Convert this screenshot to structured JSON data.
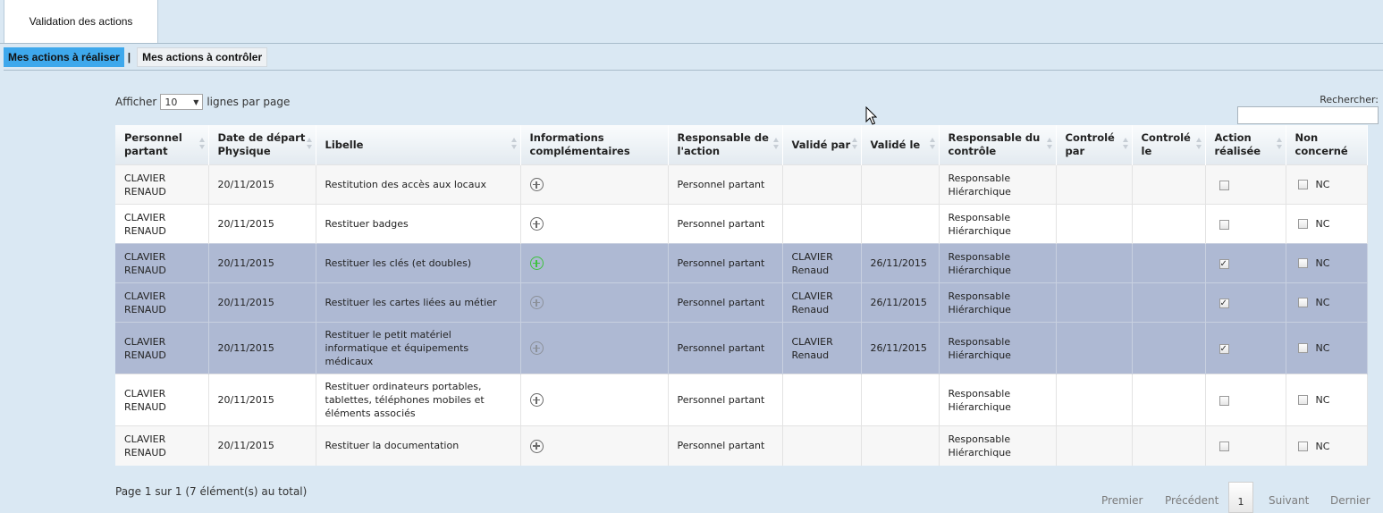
{
  "window": {
    "tab_title": "Validation des actions"
  },
  "subtabs": [
    {
      "label": "Mes actions à réaliser",
      "active": true
    },
    {
      "label": "Mes actions à contrôler",
      "active": false
    }
  ],
  "subtab_separator": "|",
  "length": {
    "prefix": "Afficher",
    "value": "10",
    "suffix": "lignes par page"
  },
  "search": {
    "label": "Rechercher:",
    "value": ""
  },
  "table": {
    "headers": [
      "Personnel partant",
      "Date de départ Physique",
      "Libelle",
      "Informations complémentaires",
      "Responsable de l'action",
      "Validé par",
      "Validé le",
      "Responsable du contrôle",
      "Controlé par",
      "Controlé le",
      "Action réalisée",
      "Non concerné"
    ],
    "rows": [
      {
        "personnel": "CLAVIER RENAUD",
        "date": "20/11/2015",
        "libelle": "Restitution des accès aux locaux",
        "responsable": "Personnel partant",
        "valide_par": "",
        "valide_le": "",
        "resp_controle": "Responsable Hiérarchique",
        "controle_par": "",
        "controle_le": "",
        "realisee": false,
        "nc_label": "NC",
        "nc": false
      },
      {
        "personnel": "CLAVIER RENAUD",
        "date": "20/11/2015",
        "libelle": "Restituer badges",
        "responsable": "Personnel partant",
        "valide_par": "",
        "valide_le": "",
        "resp_controle": "Responsable Hiérarchique",
        "controle_par": "",
        "controle_le": "",
        "realisee": false,
        "nc_label": "NC",
        "nc": false
      },
      {
        "personnel": "CLAVIER RENAUD",
        "date": "20/11/2015",
        "libelle": "Restituer les clés (et doubles)",
        "responsable": "Personnel partant",
        "valide_par": "CLAVIER Renaud",
        "valide_le": "26/11/2015",
        "resp_controle": "Responsable Hiérarchique",
        "controle_par": "",
        "controle_le": "",
        "realisee": true,
        "nc_label": "NC",
        "nc": false
      },
      {
        "personnel": "CLAVIER RENAUD",
        "date": "20/11/2015",
        "libelle": "Restituer les cartes liées au métier",
        "responsable": "Personnel partant",
        "valide_par": "CLAVIER Renaud",
        "valide_le": "26/11/2015",
        "resp_controle": "Responsable Hiérarchique",
        "controle_par": "",
        "controle_le": "",
        "realisee": true,
        "nc_label": "NC",
        "nc": false
      },
      {
        "personnel": "CLAVIER RENAUD",
        "date": "20/11/2015",
        "libelle": "Restituer le petit matériel informatique et équipements médicaux",
        "responsable": "Personnel partant",
        "valide_par": "CLAVIER Renaud",
        "valide_le": "26/11/2015",
        "resp_controle": "Responsable Hiérarchique",
        "controle_par": "",
        "controle_le": "",
        "realisee": true,
        "nc_label": "NC",
        "nc": false
      },
      {
        "personnel": "CLAVIER RENAUD",
        "date": "20/11/2015",
        "libelle": "Restituer ordinateurs portables, tablettes, téléphones mobiles et éléments associés",
        "responsable": "Personnel partant",
        "valide_par": "",
        "valide_le": "",
        "resp_controle": "Responsable Hiérarchique",
        "controle_par": "",
        "controle_le": "",
        "realisee": false,
        "nc_label": "NC",
        "nc": false
      },
      {
        "personnel": "CLAVIER RENAUD",
        "date": "20/11/2015",
        "libelle": "Restituer la documentation",
        "responsable": "Personnel partant",
        "valide_par": "",
        "valide_le": "",
        "resp_controle": "Responsable Hiérarchique",
        "controle_par": "",
        "controle_le": "",
        "realisee": false,
        "nc_label": "NC",
        "nc": false
      }
    ]
  },
  "info": "Page 1 sur 1 (7 élément(s) au total)",
  "pager": {
    "first": "Premier",
    "prev": "Précédent",
    "current": "1",
    "next": "Suivant",
    "last": "Dernier"
  },
  "colors": {
    "background": "#dae8f3",
    "active_tab": "#3ea8ec",
    "done_row": "#aeb9d3",
    "info_icon_active": "#3ec23e"
  }
}
